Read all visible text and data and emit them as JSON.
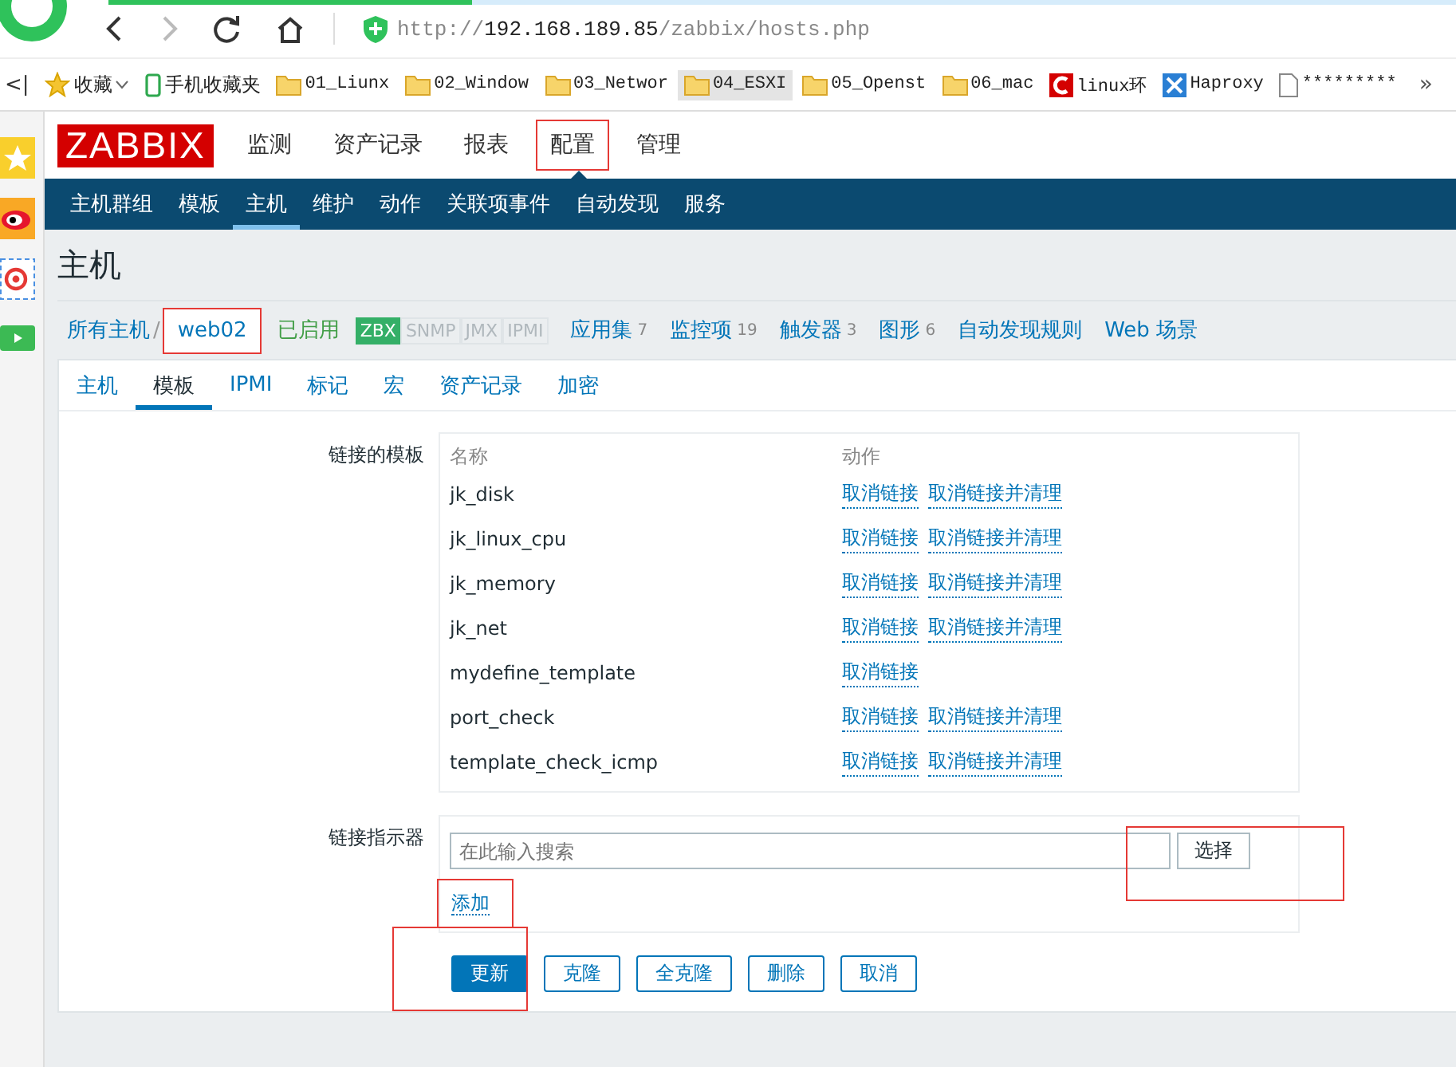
{
  "browser": {
    "load_progress": {
      "level": 0.27
    },
    "url": {
      "scheme": "http://",
      "host": "192.168.189.85",
      "path": "/zabbix/hosts.php"
    },
    "bookmarks": [
      {
        "kind": "favorites",
        "label": "收藏",
        "highlighted": false
      },
      {
        "kind": "phone",
        "label": "手机收藏夹",
        "highlighted": false
      },
      {
        "kind": "folder",
        "label": "01_Liunx",
        "highlighted": false
      },
      {
        "kind": "folder",
        "label": "02_Window",
        "highlighted": false
      },
      {
        "kind": "folder",
        "label": "03_Networ",
        "highlighted": false
      },
      {
        "kind": "folder",
        "label": "04_ESXI",
        "highlighted": true
      },
      {
        "kind": "folder",
        "label": "05_Openst",
        "highlighted": false
      },
      {
        "kind": "folder",
        "label": "06_mac",
        "highlighted": false
      },
      {
        "kind": "red-site",
        "label": "linux环",
        "highlighted": false
      },
      {
        "kind": "blue-site",
        "label": "Haproxy",
        "highlighted": false
      },
      {
        "kind": "page",
        "label": "*********",
        "highlighted": false
      }
    ],
    "more": "»",
    "toggle": "<|"
  },
  "logo": "ZABBIX",
  "main_menu": [
    {
      "label": "监测",
      "selected": false,
      "marked": false
    },
    {
      "label": "资产记录",
      "selected": false,
      "marked": false
    },
    {
      "label": "报表",
      "selected": false,
      "marked": false
    },
    {
      "label": "配置",
      "selected": true,
      "marked": true
    },
    {
      "label": "管理",
      "selected": false,
      "marked": false
    }
  ],
  "sub_menu": [
    {
      "label": "主机群组",
      "selected": false
    },
    {
      "label": "模板",
      "selected": false
    },
    {
      "label": "主机",
      "selected": true
    },
    {
      "label": "维护",
      "selected": false
    },
    {
      "label": "动作",
      "selected": false
    },
    {
      "label": "关联项事件",
      "selected": false
    },
    {
      "label": "自动发现",
      "selected": false
    },
    {
      "label": "服务",
      "selected": false
    }
  ],
  "page_title": "主机",
  "breadcrumb": {
    "all_hosts": "所有主机",
    "separator": "/",
    "host": {
      "label": "web02",
      "marked": true
    },
    "status": "已启用",
    "availability": [
      {
        "label": "ZBX",
        "on": true
      },
      {
        "label": "SNMP",
        "on": false
      },
      {
        "label": "JMX",
        "on": false
      },
      {
        "label": "IPMI",
        "on": false
      }
    ],
    "links": [
      {
        "label": "应用集",
        "count": "7"
      },
      {
        "label": "监控项",
        "count": "19"
      },
      {
        "label": "触发器",
        "count": "3"
      },
      {
        "label": "图形",
        "count": "6"
      },
      {
        "label": "自动发现规则"
      },
      {
        "label": "Web 场景"
      }
    ]
  },
  "tabs": [
    {
      "label": "主机",
      "selected": false
    },
    {
      "label": "模板",
      "selected": true
    },
    {
      "label": "IPMI",
      "selected": false
    },
    {
      "label": "标记",
      "selected": false
    },
    {
      "label": "宏",
      "selected": false
    },
    {
      "label": "资产记录",
      "selected": false
    },
    {
      "label": "加密",
      "selected": false
    }
  ],
  "linked_templates": {
    "label": "链接的模板",
    "columns": [
      "名称",
      "动作"
    ],
    "rows": [
      {
        "name": "jk_disk",
        "actions": [
          "取消链接",
          "取消链接并清理"
        ]
      },
      {
        "name": "jk_linux_cpu",
        "actions": [
          "取消链接",
          "取消链接并清理"
        ]
      },
      {
        "name": "jk_memory",
        "actions": [
          "取消链接",
          "取消链接并清理"
        ]
      },
      {
        "name": "jk_net",
        "actions": [
          "取消链接",
          "取消链接并清理"
        ]
      },
      {
        "name": "mydefine_template",
        "actions": [
          "取消链接"
        ]
      },
      {
        "name": "port_check",
        "actions": [
          "取消链接",
          "取消链接并清理"
        ]
      },
      {
        "name": "template_check_icmp",
        "actions": [
          "取消链接",
          "取消链接并清理"
        ]
      }
    ]
  },
  "link_indicator": {
    "label": "链接指示器",
    "search": {
      "placeholder": "在此输入搜索"
    },
    "select_button": {
      "label": "选择",
      "marked": true
    },
    "add_link": {
      "label": "添加",
      "marked": true
    }
  },
  "buttons": [
    {
      "label": "更新",
      "primary": true,
      "marked": true
    },
    {
      "label": "克隆",
      "primary": false,
      "marked": false
    },
    {
      "label": "全克隆",
      "primary": false,
      "marked": false
    },
    {
      "label": "删除",
      "primary": false,
      "marked": false
    },
    {
      "label": "取消",
      "primary": false,
      "marked": false
    }
  ]
}
